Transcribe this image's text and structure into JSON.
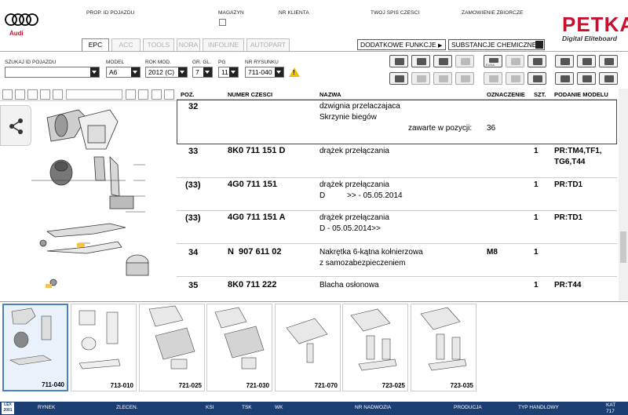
{
  "brand": {
    "audi_text": "Audi",
    "petka": "PETKA",
    "petka_sub": "Digital Eliteboard",
    "accent": "#c8102e"
  },
  "header_labels": {
    "prop_id": "PROP. ID POJAZDU",
    "magazyn": "MAGAZYN",
    "nr_klienta": "NR KLIENTA",
    "twoj_spis": "TWOJ SPIS CZESCI",
    "zamowienie": "ZAMOWIENIE ZBIORCZE"
  },
  "tabs": [
    {
      "label": "EPC",
      "active": true
    },
    {
      "label": "ACC",
      "active": false
    },
    {
      "label": "TOOLS",
      "active": false
    },
    {
      "label": "NORA",
      "active": false
    },
    {
      "label": "INFOLINE",
      "active": false
    },
    {
      "label": "AUTOPART",
      "active": false
    }
  ],
  "dropdowns": {
    "dodatkowe": "DODATKOWE FUNKCJE",
    "substancje": "SUBSTANCJE CHEMICZNE"
  },
  "fields": {
    "szukaj_label": "SZUKAJ ID POJAZDU",
    "szukaj_value": "",
    "model_label": "MODEL",
    "model_value": "A6",
    "rok_label": "ROK MOD.",
    "rok_value": "2012 (C)",
    "gr_label": "GR. GL.",
    "gr_value": "7",
    "pg_label": "PG",
    "pg_value": "11",
    "nr_label": "NR RYSUNKU",
    "nr_value": "711-040"
  },
  "warning_mark": "!",
  "toolbar_labels": {
    "eusa": "EUSA"
  },
  "table": {
    "headers": {
      "poz": "POZ.",
      "nr": "NUMER CZESCI",
      "nazwa": "NAZWA",
      "oznaczenie": "OZNACZENIE",
      "szt": "SZT.",
      "podanie": "PODANIE MODELU"
    },
    "rows": [
      {
        "poz": "32",
        "nr": "",
        "nazwa1": "dzwignia przelaczajaca",
        "nazwa2": "Skrzynie biegów",
        "extra": "zawarte w pozycji:",
        "extra_val": "36",
        "ozn": "",
        "szt": "",
        "pr1": "",
        "pr2": ""
      },
      {
        "poz": "33",
        "nr": "8K0 711 151 D",
        "nazwa1": "drążek przełączania",
        "nazwa2": "",
        "ozn": "",
        "szt": "1",
        "pr1": "PR:TM4,TF1,",
        "pr2": "TG6,T44"
      },
      {
        "poz": "(33)",
        "nr": "4G0 711 151",
        "nazwa1": "drążek przełączania",
        "nazwa2": "D          >> - 05.05.2014",
        "ozn": "",
        "szt": "1",
        "pr1": "PR:TD1",
        "pr2": ""
      },
      {
        "poz": "(33)",
        "nr": "4G0 711 151 A",
        "nazwa1": "drążek przełączania",
        "nazwa2": "D - 05.05.2014>>",
        "ozn": "",
        "szt": "1",
        "pr1": "PR:TD1",
        "pr2": ""
      },
      {
        "poz": "34",
        "nr": "N  907 611 02",
        "nazwa1": "Nakrętka 6-kątna kołnierzowa",
        "nazwa2": "z samozabezpieczeniem",
        "ozn": "M8",
        "szt": "1",
        "pr1": "",
        "pr2": ""
      },
      {
        "poz": "35",
        "nr": "8K0 711 222",
        "nazwa1": "Blacha osłonowa",
        "nazwa2": "",
        "ozn": "",
        "szt": "1",
        "pr1": "PR:T44",
        "pr2": ""
      }
    ]
  },
  "thumbnails": [
    "711-040",
    "713-010",
    "721-025",
    "721-030",
    "721-070",
    "723-025",
    "723-035"
  ],
  "status": {
    "logo": "LEX 2001",
    "rynek": "RYNEK",
    "zlecen": "ZLECEN.",
    "ksi": "KSI",
    "tsk": "TSK",
    "wk": "WK",
    "nr_nadwozia": "NR NADWOZIA",
    "produkcja": "PRODUCJA",
    "typ": "TYP HANDLOWY",
    "kat": "KAT",
    "kat_val": "717"
  }
}
